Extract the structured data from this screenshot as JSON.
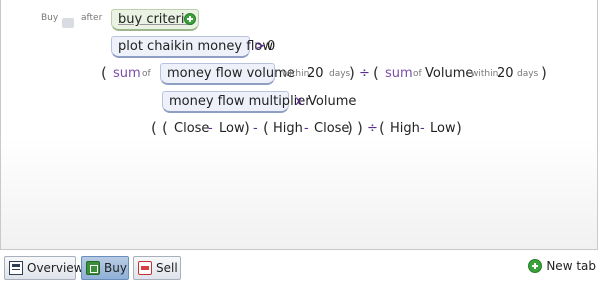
{
  "header": {
    "buy_label": "Buy",
    "after_label": "after",
    "criteria_label": "buy criteria"
  },
  "line1": {
    "block": "plot chaikin money flow",
    "op": ">",
    "value": "0"
  },
  "line2": {
    "open": "(",
    "sum1": "sum",
    "of1": "of",
    "block": "money flow volume",
    "within1": "within",
    "n1": "20",
    "days1": "days",
    "close1": ")",
    "div": "÷",
    "open2": "(",
    "sum2": "sum",
    "of2": "of",
    "volume": "Volume",
    "within2": "within",
    "n2": "20",
    "days2": "days",
    "close2": ")"
  },
  "line3": {
    "block": "money flow multiplier",
    "times": "x",
    "volume": "Volume"
  },
  "line4": {
    "t1": "(",
    "t2": "(",
    "close_a": "Close",
    "minus1": "-",
    "low_a": "Low",
    "t3": ")",
    "minus2": "-",
    "t4": "(",
    "high_a": "High",
    "minus3": "-",
    "close_b": "Close",
    "t5": ")",
    "t6": ")",
    "div": "÷",
    "t7": "(",
    "high_b": "High",
    "minus4": "-",
    "low_b": "Low",
    "t8": ")"
  },
  "tabs": [
    {
      "label": "Overview",
      "icon": "overview-icon"
    },
    {
      "label": "Buy",
      "icon": "buy-icon"
    },
    {
      "label": "Sell",
      "icon": "sell-icon"
    }
  ],
  "new_tab_label": "New tab"
}
